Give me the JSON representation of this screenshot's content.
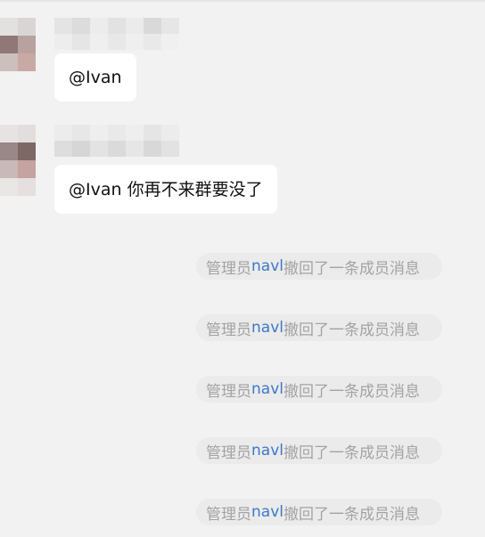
{
  "messages": [
    {
      "text": "@Ivan"
    },
    {
      "text": "@Ivan 你再不来群要没了"
    }
  ],
  "recall_notices": [
    {
      "prefix": "管理员",
      "admin": "navl",
      "suffix": "撤回了一条成员消息"
    },
    {
      "prefix": "管理员",
      "admin": "navl",
      "suffix": "撤回了一条成员消息"
    },
    {
      "prefix": "管理员",
      "admin": "navl",
      "suffix": "撤回了一条成员消息"
    },
    {
      "prefix": "管理员",
      "admin": "navl",
      "suffix": "撤回了一条成员消息"
    },
    {
      "prefix": "管理员",
      "admin": "navl",
      "suffix": "撤回了一条成员消息"
    }
  ],
  "colors": {
    "background": "#f2f2f2",
    "bubble": "#ffffff",
    "admin_link": "#3d78c7",
    "notice_text": "#a3a3a3"
  }
}
